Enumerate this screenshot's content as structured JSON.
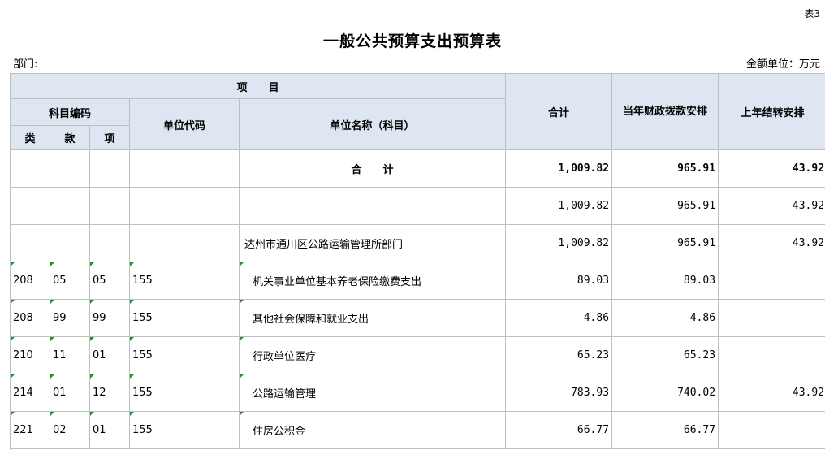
{
  "table_no": "表3",
  "title": "一般公共预算支出预算表",
  "dept_label": "部门:",
  "unit_label": "金额单位：万元",
  "headers": {
    "item": "项　　目",
    "subject_code": "科目编码",
    "lei": "类",
    "kuan": "款",
    "xiang": "项",
    "unit_code": "单位代码",
    "unit_name": "单位名称（科目）",
    "total": "合计",
    "current": "当年财政拨款安排",
    "carry": "上年结转安排"
  },
  "total_row": {
    "label": "合　　计",
    "total": "1,009.82",
    "current": "965.91",
    "carry": "43.92"
  },
  "rows": [
    {
      "lei": "",
      "kuan": "",
      "xiang": "",
      "code": "",
      "name": "",
      "total": "1,009.82",
      "current": "965.91",
      "carry": "43.92"
    },
    {
      "lei": "",
      "kuan": "",
      "xiang": "",
      "code": "",
      "name": "达州市通川区公路运输管理所部门",
      "total": "1,009.82",
      "current": "965.91",
      "carry": "43.92"
    },
    {
      "lei": "208",
      "kuan": "05",
      "xiang": "05",
      "code": "155",
      "name": "机关事业单位基本养老保险缴费支出",
      "total": "89.03",
      "current": "89.03",
      "carry": ""
    },
    {
      "lei": "208",
      "kuan": "99",
      "xiang": "99",
      "code": "155",
      "name": "其他社会保障和就业支出",
      "total": "4.86",
      "current": "4.86",
      "carry": ""
    },
    {
      "lei": "210",
      "kuan": "11",
      "xiang": "01",
      "code": "155",
      "name": "行政单位医疗",
      "total": "65.23",
      "current": "65.23",
      "carry": ""
    },
    {
      "lei": "214",
      "kuan": "01",
      "xiang": "12",
      "code": "155",
      "name": "公路运输管理",
      "total": "783.93",
      "current": "740.02",
      "carry": "43.92"
    },
    {
      "lei": "221",
      "kuan": "02",
      "xiang": "01",
      "code": "155",
      "name": "住房公积金",
      "total": "66.77",
      "current": "66.77",
      "carry": ""
    }
  ],
  "colors": {
    "header_bg": "#dde6f1",
    "grid": "#bfbfbf",
    "marker": "#2e8b2e"
  }
}
